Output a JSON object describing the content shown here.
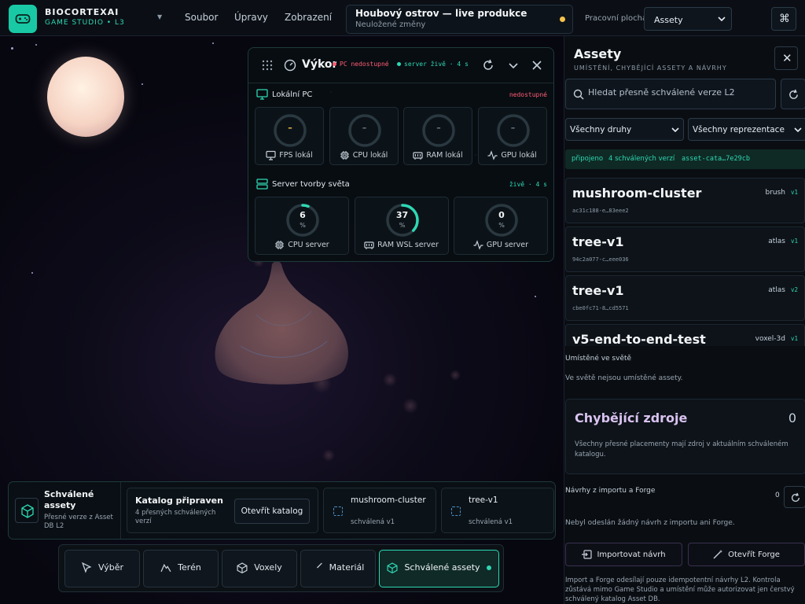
{
  "app": {
    "brand": "BIOCORTEXAI",
    "subtitle": "GAME STUDIO • L3",
    "menu": [
      "Soubor",
      "Úpravy",
      "Zobrazení"
    ],
    "document_title": "Houbový ostrov — live produkce",
    "document_status": "Neuložené změny",
    "workspace_label": "Pracovní plocha",
    "workspace_value": "Assety",
    "icons": {
      "logo": "gamepad-icon",
      "command": "command-icon"
    }
  },
  "performance": {
    "title": "Výkon",
    "pc_status": "PC nedostupné",
    "server_status": "server živě · 4 s",
    "local": {
      "title": "Lokální PC",
      "status": "nedostupné",
      "tiles": [
        {
          "label": "FPS lokál",
          "value": "–",
          "icon": "monitor-icon"
        },
        {
          "label": "CPU lokál",
          "value": "–",
          "icon": "cpu-icon"
        },
        {
          "label": "RAM lokál",
          "value": "–",
          "icon": "memory-icon"
        },
        {
          "label": "GPU lokál",
          "value": "–",
          "icon": "activity-icon"
        }
      ]
    },
    "server": {
      "title": "Server tvorby světa",
      "status": "živě · 4 s",
      "tiles": [
        {
          "label": "CPU server",
          "value": "6",
          "unit": "%",
          "percent": 6,
          "icon": "cpu-icon"
        },
        {
          "label": "RAM WSL server",
          "value": "37",
          "unit": "%",
          "percent": 37,
          "icon": "memory-icon"
        },
        {
          "label": "GPU server",
          "value": "0",
          "unit": "%",
          "percent": 0,
          "icon": "activity-icon"
        }
      ]
    },
    "colors": {
      "accent": "#2ed8b3",
      "offline": "#ff5d73",
      "warning": "#f5c34d"
    }
  },
  "assets_panel": {
    "title": "Assety",
    "subtitle": "UMÍSTĚNÍ, CHYBĚJÍCÍ ASSETY A NÁVRHY",
    "search_placeholder": "Hledat přesně schválené verze L2",
    "filter_kind": "Všechny druhy",
    "filter_repr": "Všechny reprezentace",
    "connection": {
      "state": "připojeno",
      "count": "4 schválených verzí",
      "catalog": "asset-cata…7e29cb"
    },
    "items": [
      {
        "name": "mushroom-cluster",
        "hash": "ac31c188-e…83eee2",
        "type": "brush",
        "version": "v1"
      },
      {
        "name": "tree-v1",
        "hash": "94c2a077-c…eee036",
        "type": "atlas",
        "version": "v1"
      },
      {
        "name": "tree-v1",
        "hash": "cbe0fc71-8…cd5571",
        "type": "atlas",
        "version": "v2"
      },
      {
        "name": "v5-end-to-end-test",
        "hash": "",
        "type": "voxel-3d",
        "version": "v1"
      }
    ],
    "placed_title": "Umístěné ve světě",
    "placed_text": "Ve světě nejsou umístěné assety.",
    "missing_title": "Chybějící zdroje",
    "missing_count": "0",
    "missing_text": "Všechny přesné placementy mají zdroj v aktuálním schváleném katalogu.",
    "forge_title": "Návrhy z importu a Forge",
    "forge_count": "0",
    "forge_text": "Nebyl odeslán žádný návrh z importu ani Forge.",
    "import_button": "Importovat návrh",
    "forge_button": "Otevřít Forge",
    "footer_text": "Import a Forge odesílají pouze idempotentní návrhy L2. Kontrola zůstává mimo Game Studio a umístění může autorizovat jen čerstvý schválený katalog Asset DB."
  },
  "approved_strip": {
    "title": "Schválené assety",
    "subtitle": "Přesné verze z Asset DB L2",
    "catalog_title": "Katalog připraven",
    "catalog_sub": "4 přesných schválených verzí",
    "open_catalog": "Otevřít katalog",
    "items": [
      {
        "name": "mushroom-cluster",
        "status": "schválená v1"
      },
      {
        "name": "tree-v1",
        "status": "schválená v1"
      }
    ]
  },
  "toolbar": {
    "items": [
      {
        "label": "Výběr",
        "icon": "cursor-icon"
      },
      {
        "label": "Terén",
        "icon": "mountain-icon"
      },
      {
        "label": "Voxely",
        "icon": "cube-icon"
      },
      {
        "label": "Materiál",
        "icon": "paintbrush-icon"
      },
      {
        "label": "Schválené assety",
        "icon": "package-icon",
        "active": true
      }
    ]
  }
}
